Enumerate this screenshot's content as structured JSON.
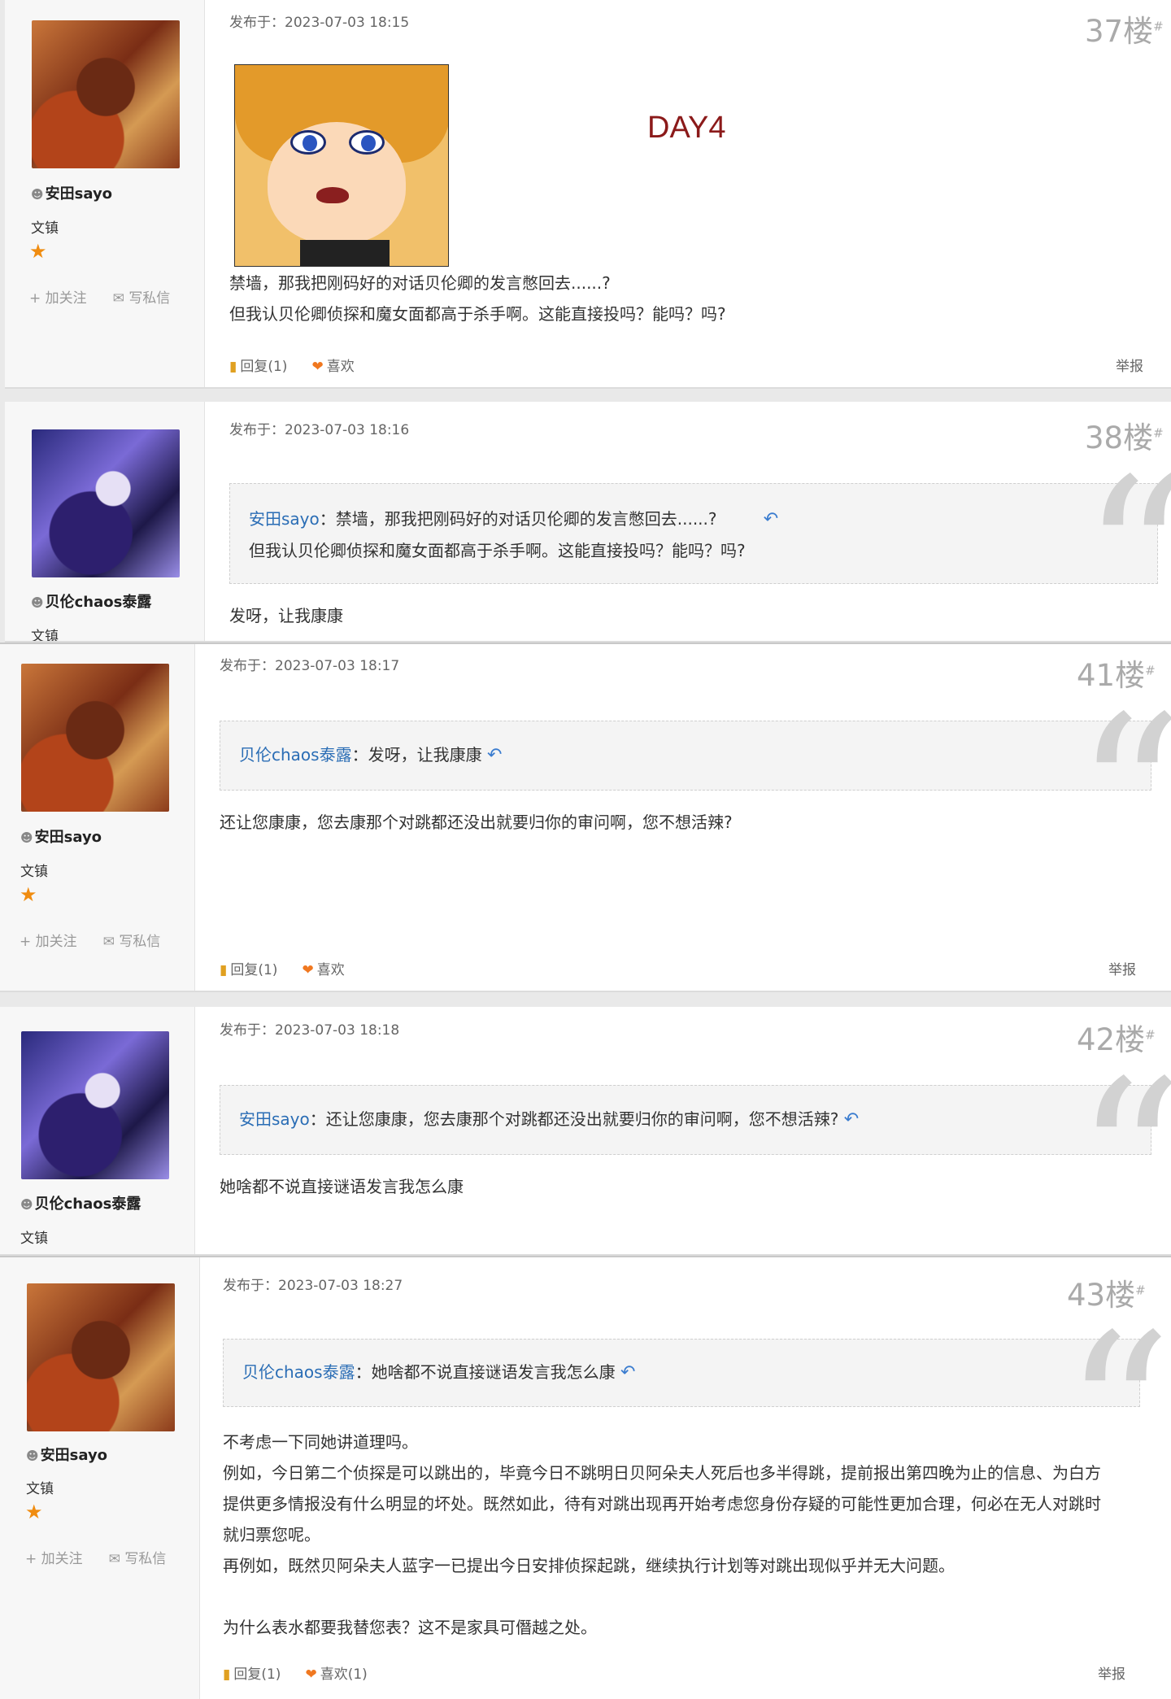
{
  "posts": [
    {
      "user": "安田sayo",
      "level": "文镇",
      "follow": "加关注",
      "message": "写私信",
      "time": "发布于：2023-07-03 18:15",
      "floor": "37楼",
      "sticker_text": "DAY4",
      "lines": [
        "禁墙，那我把刚码好的对话贝伦卿的发言憋回去......?",
        "但我认贝伦卿侦探和魔女面都高于杀手啊。这能直接投吗？能吗？吗?"
      ],
      "reply": "回复(1)",
      "like": "喜欢",
      "report": "举报"
    },
    {
      "user": "贝伦chaos泰露",
      "level": "文镇",
      "time": "发布于：2023-07-03 18:16",
      "floor": "38楼",
      "quote_user": "安田sayo",
      "quote_lines": [
        "：禁墙，那我把刚码好的对话贝伦卿的发言憋回去......?",
        "但我认贝伦卿侦探和魔女面都高于杀手啊。这能直接投吗？能吗？吗?"
      ],
      "lines": [
        "发呀，让我康康"
      ]
    },
    {
      "user": "安田sayo",
      "level": "文镇",
      "follow": "加关注",
      "message": "写私信",
      "time": "发布于：2023-07-03 18:17",
      "floor": "41楼",
      "quote_user": "贝伦chaos泰露",
      "quote_lines": [
        "：发呀，让我康康"
      ],
      "lines": [
        "还让您康康，您去康那个对跳都还没出就要归你的审问啊，您不想活辣?"
      ],
      "reply": "回复(1)",
      "like": "喜欢",
      "report": "举报"
    },
    {
      "user": "贝伦chaos泰露",
      "level": "文镇",
      "time": "发布于：2023-07-03 18:18",
      "floor": "42楼",
      "quote_user": "安田sayo",
      "quote_lines": [
        "：还让您康康，您去康那个对跳都还没出就要归你的审问啊，您不想活辣?"
      ],
      "lines": [
        "她啥都不说直接谜语发言我怎么康"
      ]
    },
    {
      "user": "安田sayo",
      "level": "文镇",
      "follow": "加关注",
      "message": "写私信",
      "time": "发布于：2023-07-03 18:27",
      "floor": "43楼",
      "quote_user": "贝伦chaos泰露",
      "quote_lines": [
        "：她啥都不说直接谜语发言我怎么康"
      ],
      "lines": [
        "不考虑一下同她讲道理吗。",
        "例如，今日第二个侦探是可以跳出的，毕竟今日不跳明日贝阿朵夫人死后也多半得跳，提前报出第四晚为止的信息、为白方",
        "提供更多情报没有什么明显的坏处。既然如此，待有对跳出现再开始考虑您身份存疑的可能性更加合理，何必在无人对跳时",
        "就归票您呢。",
        "再例如，既然贝阿朵夫人蓝字一已提出今日安排侦探起跳，继续执行计划等对跳出现似乎并无大问题。",
        "",
        "为什么表水都要我替您表？这不是家具可僭越之处。"
      ],
      "reply": "回复(1)",
      "like": "喜欢(1)",
      "report": "举报"
    }
  ]
}
